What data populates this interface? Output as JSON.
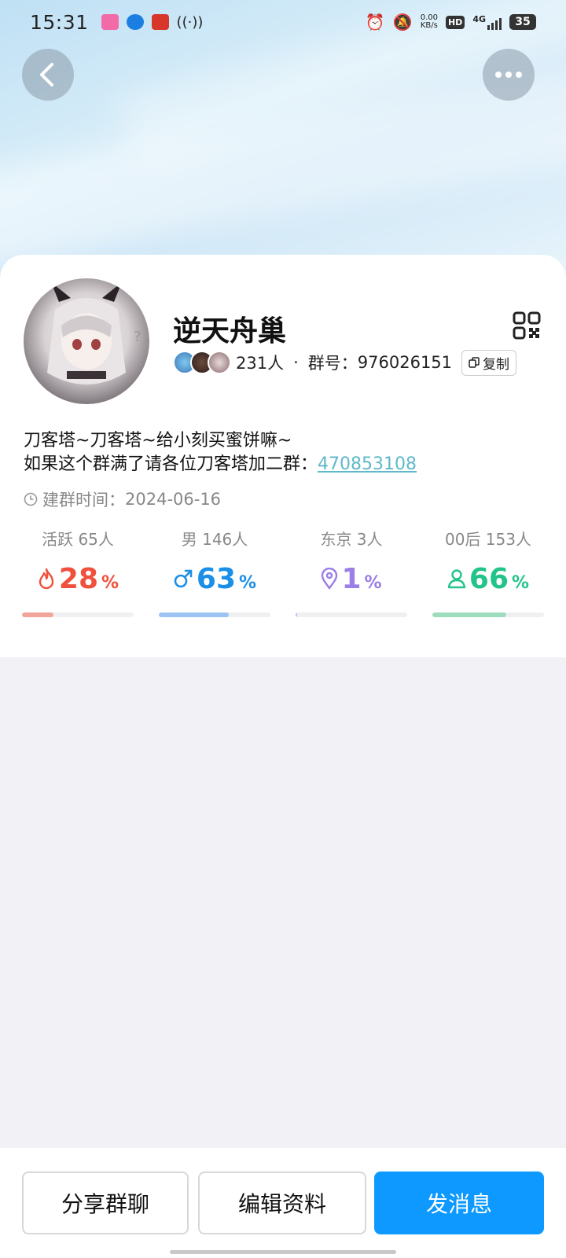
{
  "status_bar": {
    "time": "15:31",
    "net_speed": "0.00\nKB/s",
    "hd": "HD",
    "network": "4G",
    "battery": "35"
  },
  "header": {
    "back_icon": "chevron-left-icon",
    "more_icon": "more-dots-icon"
  },
  "group": {
    "name": "逆天舟巢",
    "member_count": "231人",
    "id_label": "群号：",
    "id_value": "976026151",
    "copy_label": "复制",
    "desc_line1": "刀客塔~刀客塔~给小刻买蜜饼嘛~",
    "desc_line2_prefix": "如果这个群满了请各位刀客塔加二群：",
    "desc_line2_link": "470853108",
    "created_label": "建群时间：",
    "created_date": "2024-06-16"
  },
  "stats": [
    {
      "label": "活跃 65人",
      "value": "28",
      "unit": "%",
      "icon": "flame-icon",
      "color": "#f0503c",
      "bar_color": "#f2a69b",
      "percent": 28
    },
    {
      "label": "男 146人",
      "value": "63",
      "unit": "%",
      "icon": "male-icon",
      "color": "#1a8fe8",
      "bar_color": "#9cc4f2",
      "percent": 63
    },
    {
      "label": "东京 3人",
      "value": "1",
      "unit": "%",
      "icon": "location-pin-icon",
      "color": "#9b7ee6",
      "bar_color": "#c9b9f0",
      "percent": 1
    },
    {
      "label": "00后 153人",
      "value": "66",
      "unit": "%",
      "icon": "person-icon",
      "color": "#23c48a",
      "bar_color": "#9ddcbc",
      "percent": 66
    }
  ],
  "actions": {
    "share": "分享群聊",
    "edit": "编辑资料",
    "message": "发消息"
  }
}
